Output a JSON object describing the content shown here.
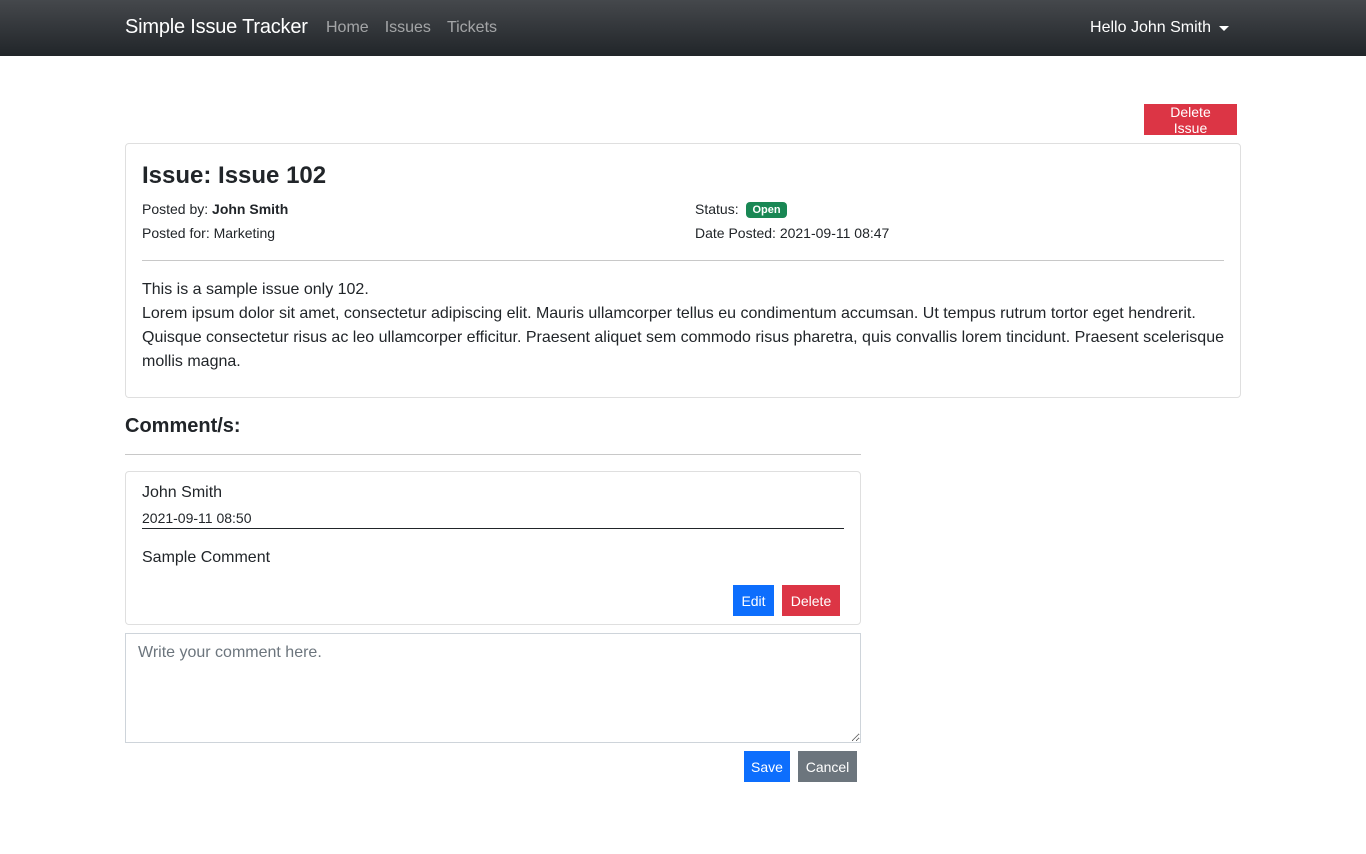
{
  "navbar": {
    "brand": "Simple Issue Tracker",
    "links": [
      "Home",
      "Issues",
      "Tickets"
    ],
    "user_greeting": "Hello John Smith",
    "user_menu_icon": "caret-down-icon"
  },
  "actions": {
    "delete_issue_label": "Delete Issue"
  },
  "issue": {
    "title": "Issue: Issue 102",
    "posted_by_label": "Posted by:",
    "posted_by": "John Smith",
    "posted_for_label": "Posted for:",
    "posted_for": "Marketing",
    "status_label": "Status:",
    "status": "Open",
    "date_label": "Date Posted:",
    "date": "2021-09-11 08:47",
    "body_line1": "This is a sample issue only 102.",
    "body_line2": "Lorem ipsum dolor sit amet, consectetur adipiscing elit. Mauris ullamcorper tellus eu condimentum accumsan. Ut tempus rutrum tortor eget hendrerit. Quisque consectetur risus ac leo ullamcorper efficitur. Praesent aliquet sem commodo risus pharetra, quis convallis lorem tincidunt. Praesent scelerisque mollis magna."
  },
  "comments": {
    "heading": "Comment/s:",
    "items": [
      {
        "author": "John Smith",
        "date": "2021-09-11 08:50",
        "text": "Sample Comment",
        "edit_label": "Edit",
        "delete_label": "Delete"
      }
    ],
    "input_placeholder": "Write your comment here.",
    "input_value": "",
    "save_label": "Save",
    "cancel_label": "Cancel"
  },
  "colors": {
    "danger": "#dc3545",
    "primary": "#0d6efd",
    "secondary": "#6c757d",
    "success": "#198754",
    "navbar": "#212529"
  }
}
